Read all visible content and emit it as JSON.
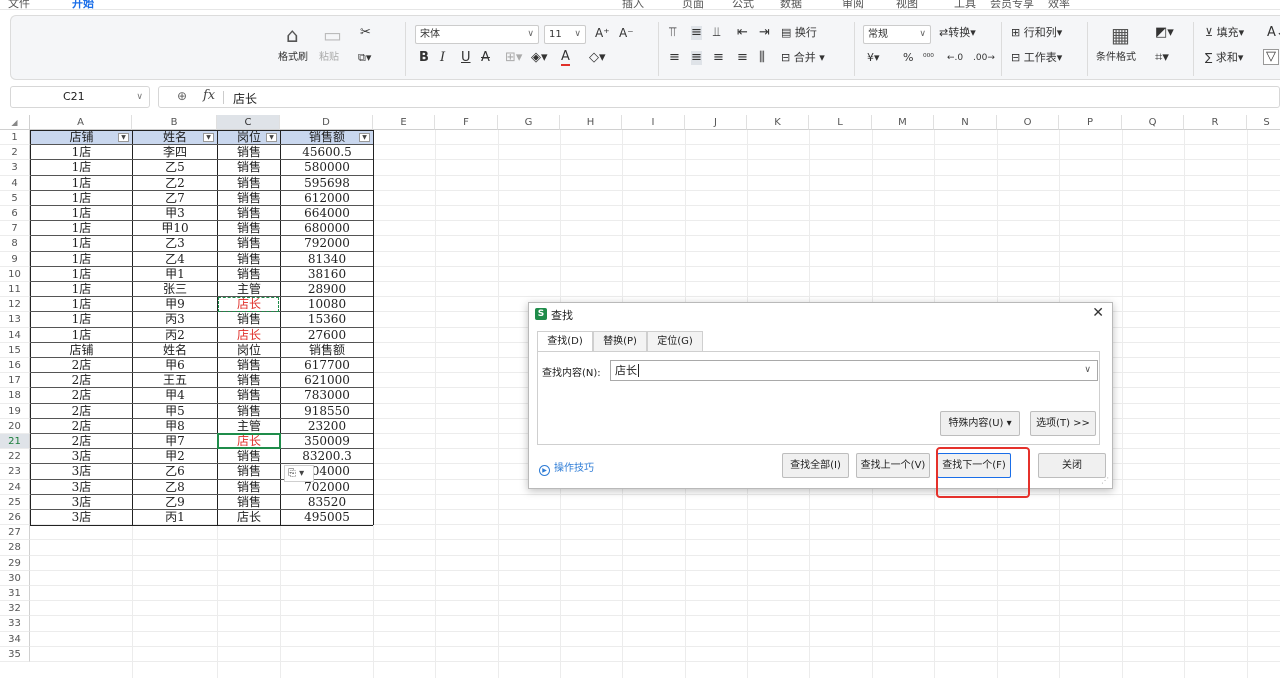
{
  "top_tabs": [
    "文件",
    "开始",
    "插入",
    "页面",
    "公式",
    "数据",
    "审阅",
    "视图",
    "工具",
    "会员专享",
    "效率"
  ],
  "top_active_tab": "开始",
  "ribbon": {
    "format_painter": "格式刷",
    "paste": "粘贴",
    "font_name": "宋体",
    "font_size": "11",
    "wrap": "换行",
    "merge": "合并",
    "number_format": "常规",
    "convert": "转换",
    "rows_cols": "行和列",
    "worksheet": "工作表",
    "cond_format": "条件格式",
    "fill": "填充",
    "sum": "求和",
    "currency": "¥",
    "percent": "%"
  },
  "formula_bar": {
    "cell_ref": "C21",
    "fx": "fx",
    "value": "店长"
  },
  "columns": [
    "A",
    "B",
    "C",
    "D",
    "E",
    "F",
    "G",
    "H",
    "I",
    "J",
    "K",
    "L",
    "M",
    "N",
    "O",
    "P",
    "Q",
    "R",
    "S"
  ],
  "selected_column": "C",
  "selected_row": "21",
  "row_numbers": [
    "1",
    "2",
    "3",
    "4",
    "5",
    "6",
    "7",
    "8",
    "9",
    "10",
    "11",
    "12",
    "13",
    "14",
    "15",
    "16",
    "17",
    "18",
    "19",
    "20",
    "21",
    "22",
    "23",
    "24",
    "25",
    "26",
    "27",
    "28",
    "29",
    "30",
    "31",
    "32",
    "33",
    "34",
    "35"
  ],
  "table": {
    "headers": [
      "店铺",
      "姓名",
      "岗位",
      "销售额"
    ],
    "rows": [
      [
        "1店",
        "李四",
        "销售",
        "45600.5"
      ],
      [
        "1店",
        "乙5",
        "销售",
        "580000"
      ],
      [
        "1店",
        "乙2",
        "销售",
        "595698"
      ],
      [
        "1店",
        "乙7",
        "销售",
        "612000"
      ],
      [
        "1店",
        "甲3",
        "销售",
        "664000"
      ],
      [
        "1店",
        "甲10",
        "销售",
        "680000"
      ],
      [
        "1店",
        "乙3",
        "销售",
        "792000"
      ],
      [
        "1店",
        "乙4",
        "销售",
        "81340"
      ],
      [
        "1店",
        "甲1",
        "销售",
        "38160"
      ],
      [
        "1店",
        "张三",
        "主管",
        "28900"
      ],
      [
        "1店",
        "甲9",
        "店长",
        "10080"
      ],
      [
        "1店",
        "丙3",
        "销售",
        "15360"
      ],
      [
        "1店",
        "丙2",
        "店长",
        "27600"
      ],
      [
        "店铺",
        "姓名",
        "岗位",
        "销售额"
      ],
      [
        "2店",
        "甲6",
        "销售",
        "617700"
      ],
      [
        "2店",
        "王五",
        "销售",
        "621000"
      ],
      [
        "2店",
        "甲4",
        "销售",
        "783000"
      ],
      [
        "2店",
        "甲5",
        "销售",
        "918550"
      ],
      [
        "2店",
        "甲8",
        "主管",
        "23200"
      ],
      [
        "2店",
        "甲7",
        "店长",
        "350009"
      ],
      [
        "3店",
        "甲2",
        "销售",
        "83200.3"
      ],
      [
        "3店",
        "乙6",
        "销售",
        "504000"
      ],
      [
        "3店",
        "乙8",
        "销售",
        "702000"
      ],
      [
        "3店",
        "乙9",
        "销售",
        "83520"
      ],
      [
        "3店",
        "丙1",
        "店长",
        "495005"
      ]
    ]
  },
  "dialog": {
    "title": "查找",
    "tabs": [
      "查找(D)",
      "替换(P)",
      "定位(G)"
    ],
    "find_label": "查找内容(N):",
    "find_value": "店长",
    "special_btn": "特殊内容(U) ▾",
    "options_btn": "选项(T) >>",
    "tips": "操作技巧",
    "find_all": "查找全部(I)",
    "find_prev": "查找上一个(V)",
    "find_next": "查找下一个(F)",
    "close": "关闭"
  },
  "colors": {
    "accent": "#1a6ee8",
    "header_fill": "#c9d7ee",
    "found_text": "#e0302a",
    "highlight_box": "#e5312b",
    "active_cell": "#1f8c4a"
  }
}
